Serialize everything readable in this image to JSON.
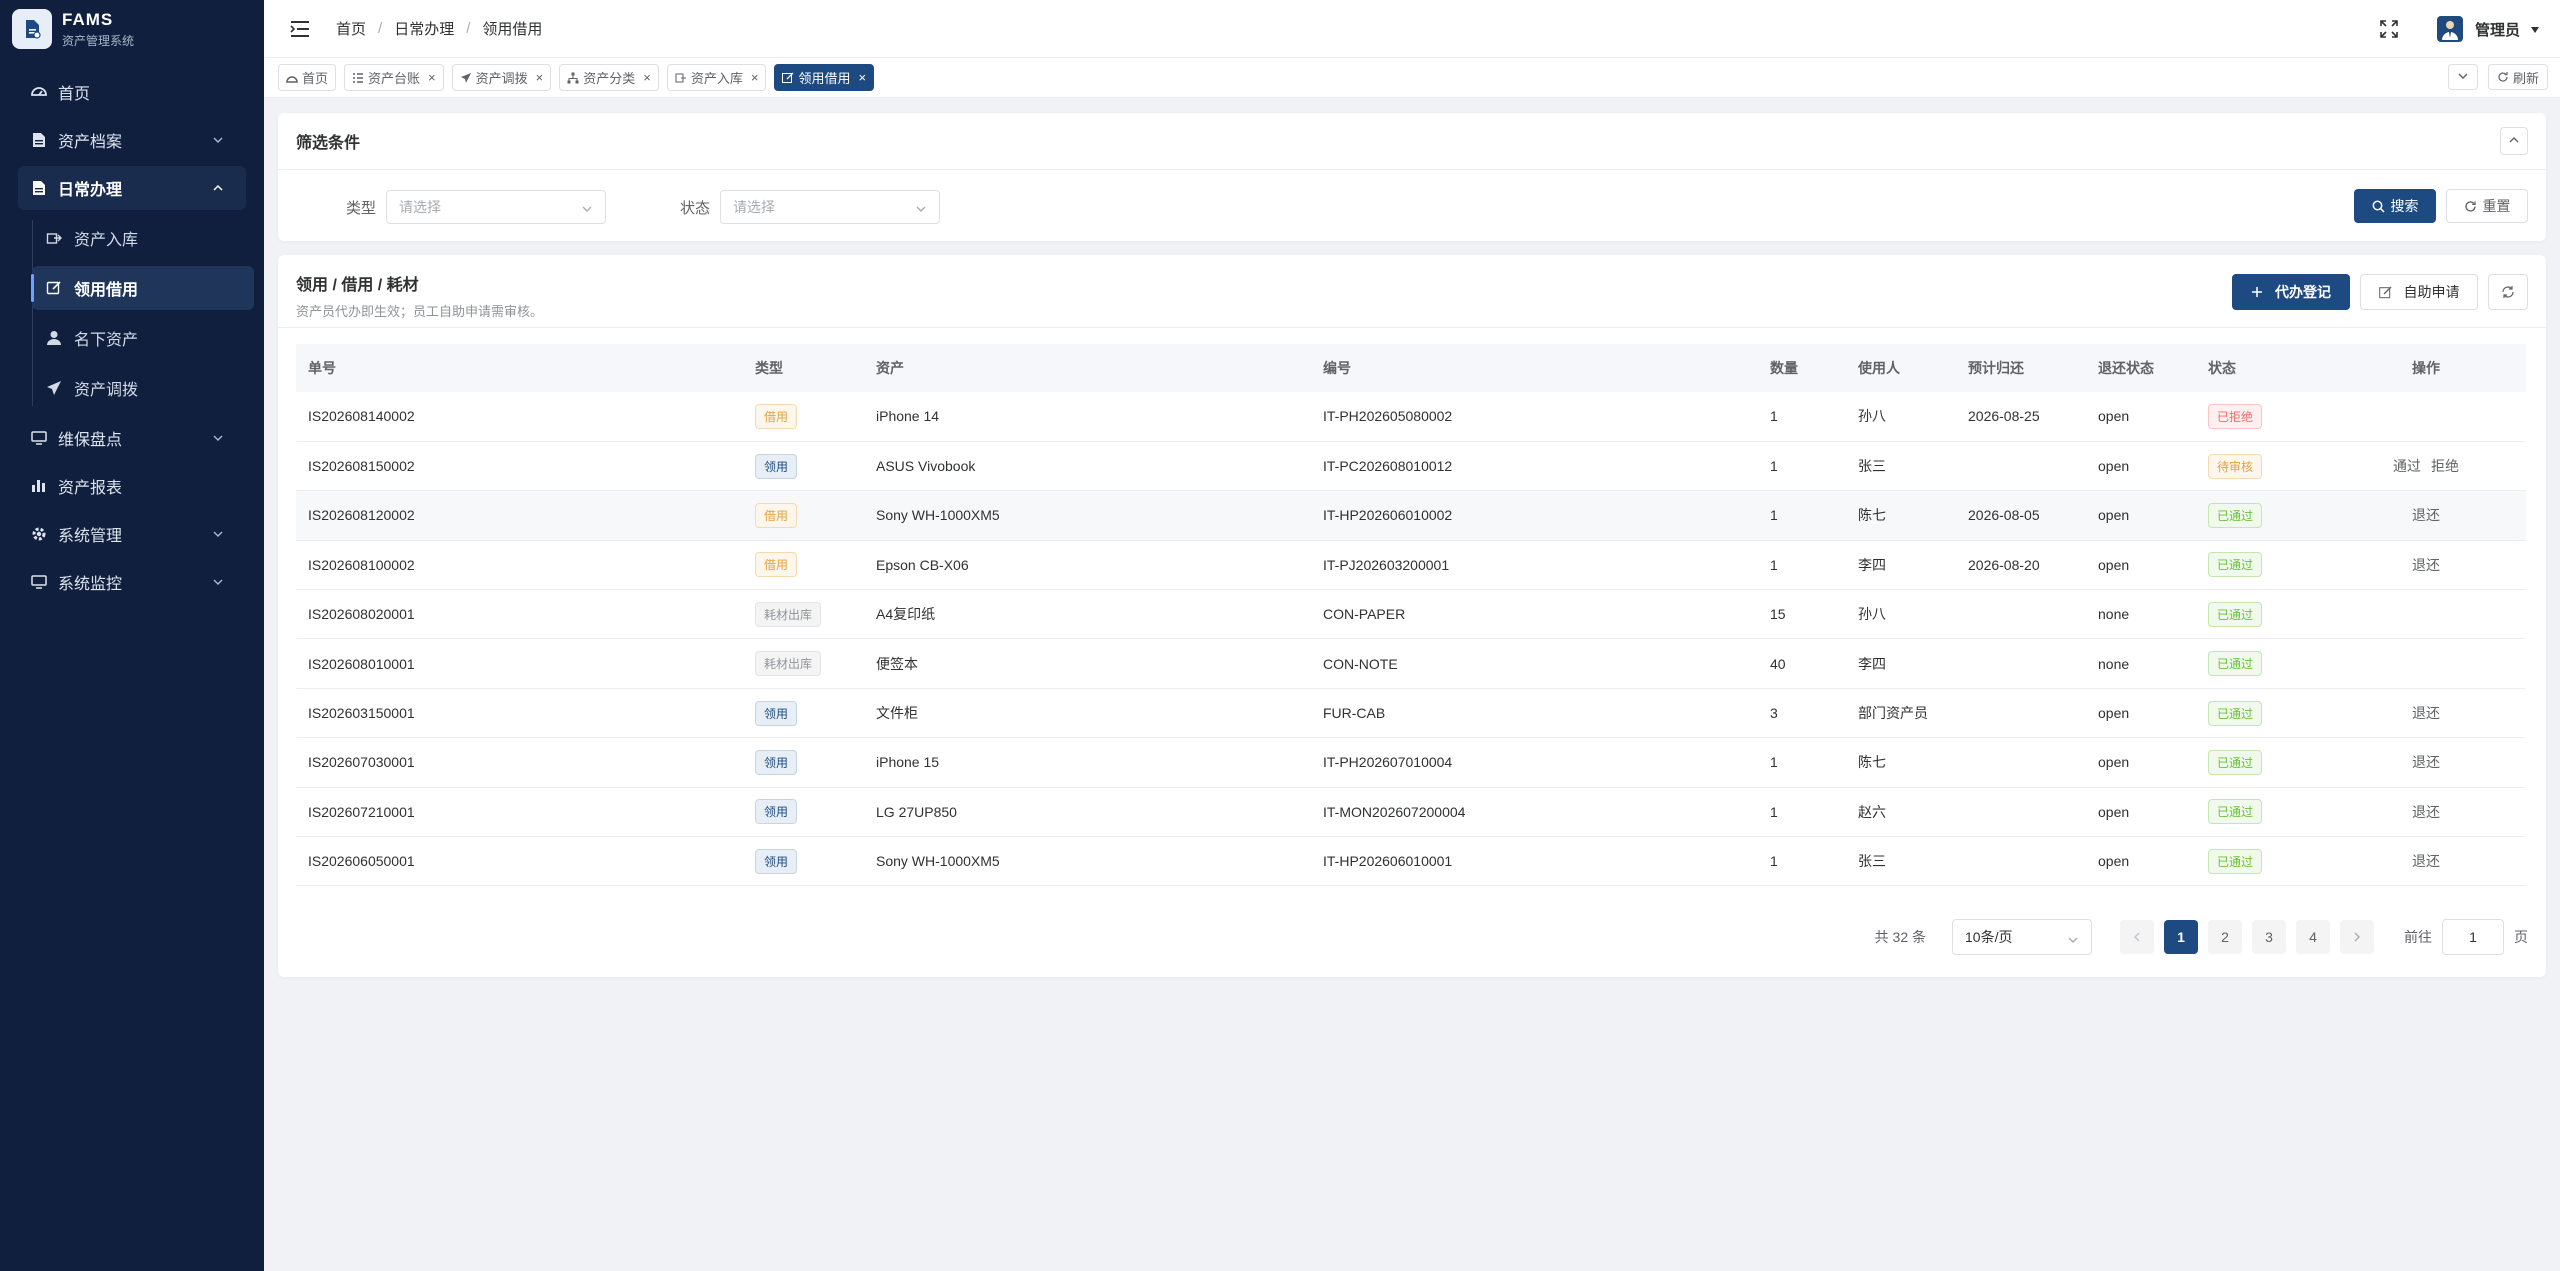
{
  "brand": {
    "title": "FAMS",
    "subtitle": "资产管理系统"
  },
  "sidebar": {
    "items": [
      {
        "label": "首页",
        "icon": "dashboard-icon"
      },
      {
        "label": "资产档案",
        "icon": "document-icon"
      },
      {
        "label": "日常办理",
        "icon": "document-icon",
        "open": true
      },
      {
        "label": "维保盘点",
        "icon": "monitor-icon"
      },
      {
        "label": "资产报表",
        "icon": "bar-chart-icon"
      },
      {
        "label": "系统管理",
        "icon": "gear-icon"
      },
      {
        "label": "系统监控",
        "icon": "monitor-icon"
      }
    ],
    "sub_items": [
      {
        "label": "资产入库",
        "icon": "box-icon"
      },
      {
        "label": "领用借用",
        "icon": "edit-icon",
        "active": true
      },
      {
        "label": "名下资产",
        "icon": "user-icon"
      },
      {
        "label": "资产调拨",
        "icon": "send-icon"
      }
    ]
  },
  "header": {
    "breadcrumb": [
      "首页",
      "日常办理",
      "领用借用"
    ],
    "user": "管理员"
  },
  "tags": [
    {
      "label": "首页",
      "icon": "dashboard-icon"
    },
    {
      "label": "资产台账",
      "icon": "list-icon",
      "closable": true
    },
    {
      "label": "资产调拨",
      "icon": "send-icon",
      "closable": true
    },
    {
      "label": "资产分类",
      "icon": "tree-icon",
      "closable": true
    },
    {
      "label": "资产入库",
      "icon": "box-icon",
      "closable": true
    },
    {
      "label": "领用借用",
      "icon": "edit-icon",
      "closable": true,
      "active": true
    }
  ],
  "tags_refresh": "刷新",
  "filter": {
    "title": "筛选条件",
    "type_label": "类型",
    "type_placeholder": "请选择",
    "status_label": "状态",
    "status_placeholder": "请选择",
    "search": "搜索",
    "reset": "重置"
  },
  "list": {
    "title": "领用 / 借用 / 耗材",
    "subtitle": "资产员代办即生效；员工自助申请需审核。",
    "register": "代办登记",
    "self_apply": "自助申请",
    "columns": [
      "单号",
      "类型",
      "资产",
      "编号",
      "数量",
      "使用人",
      "预计归还",
      "退还状态",
      "状态",
      "操作"
    ],
    "rows": [
      {
        "no": "IS202608140002",
        "type": "借用",
        "type_kind": "jy",
        "asset": "iPhone 14",
        "code": "IT-PH202605080002",
        "qty": "1",
        "user": "孙八",
        "due": "2026-08-25",
        "return": "open",
        "status": "已拒绝",
        "status_kind": "rej",
        "ops": []
      },
      {
        "no": "IS202608150002",
        "type": "领用",
        "type_kind": "ly",
        "asset": "ASUS Vivobook",
        "code": "IT-PC202608010012",
        "qty": "1",
        "user": "张三",
        "due": "",
        "return": "open",
        "status": "待审核",
        "status_kind": "wait",
        "ops": [
          "通过",
          "拒绝"
        ]
      },
      {
        "no": "IS202608120002",
        "type": "借用",
        "type_kind": "jy",
        "asset": "Sony WH-1000XM5",
        "code": "IT-HP202606010002",
        "qty": "1",
        "user": "陈七",
        "due": "2026-08-05",
        "return": "open",
        "status": "已通过",
        "status_kind": "ok",
        "ops": [
          "退还"
        ]
      },
      {
        "no": "IS202608100002",
        "type": "借用",
        "type_kind": "jy",
        "asset": "Epson CB-X06",
        "code": "IT-PJ202603200001",
        "qty": "1",
        "user": "李四",
        "due": "2026-08-20",
        "return": "open",
        "status": "已通过",
        "status_kind": "ok",
        "ops": [
          "退还"
        ]
      },
      {
        "no": "IS202608020001",
        "type": "耗材出库",
        "type_kind": "hc",
        "asset": "A4复印纸",
        "code": "CON-PAPER",
        "qty": "15",
        "user": "孙八",
        "due": "",
        "return": "none",
        "status": "已通过",
        "status_kind": "ok",
        "ops": []
      },
      {
        "no": "IS202608010001",
        "type": "耗材出库",
        "type_kind": "hc",
        "asset": "便签本",
        "code": "CON-NOTE",
        "qty": "40",
        "user": "李四",
        "due": "",
        "return": "none",
        "status": "已通过",
        "status_kind": "ok",
        "ops": []
      },
      {
        "no": "IS202603150001",
        "type": "领用",
        "type_kind": "ly",
        "asset": "文件柜",
        "code": "FUR-CAB",
        "qty": "3",
        "user": "部门资产员",
        "due": "",
        "return": "open",
        "status": "已通过",
        "status_kind": "ok",
        "ops": [
          "退还"
        ]
      },
      {
        "no": "IS202607030001",
        "type": "领用",
        "type_kind": "ly",
        "asset": "iPhone 15",
        "code": "IT-PH202607010004",
        "qty": "1",
        "user": "陈七",
        "due": "",
        "return": "open",
        "status": "已通过",
        "status_kind": "ok",
        "ops": [
          "退还"
        ]
      },
      {
        "no": "IS202607210001",
        "type": "领用",
        "type_kind": "ly",
        "asset": "LG 27UP850",
        "code": "IT-MON202607200004",
        "qty": "1",
        "user": "赵六",
        "due": "",
        "return": "open",
        "status": "已通过",
        "status_kind": "ok",
        "ops": [
          "退还"
        ]
      },
      {
        "no": "IS202606050001",
        "type": "领用",
        "type_kind": "ly",
        "asset": "Sony WH-1000XM5",
        "code": "IT-HP202606010001",
        "qty": "1",
        "user": "张三",
        "due": "",
        "return": "open",
        "status": "已通过",
        "status_kind": "ok",
        "ops": [
          "退还"
        ]
      }
    ]
  },
  "pagination": {
    "total": "共 32 条",
    "page_size": "10条/页",
    "pages": [
      "1",
      "2",
      "3",
      "4"
    ],
    "current": "1",
    "goto_label": "前往",
    "goto_value": "1",
    "page_suffix": "页"
  },
  "colors": {
    "sidebar_bg": "#0f1f3d",
    "primary": "#1d4a80"
  }
}
